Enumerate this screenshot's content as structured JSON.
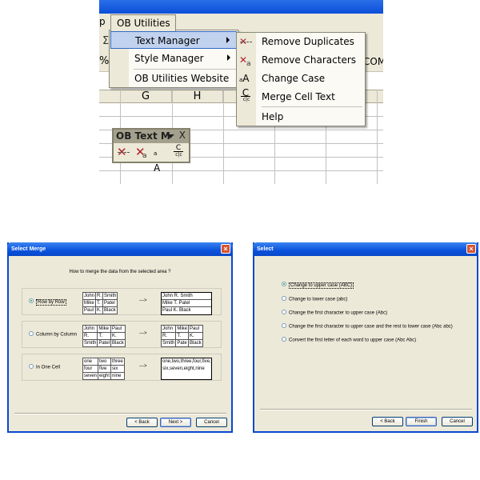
{
  "excel": {
    "menubar_partial_label": "p",
    "menubar_active": "OB Utilities",
    "toolbar_partial": {
      "sigma": "Σ",
      "percent": "%",
      "com": "COM"
    },
    "columns": [
      "G",
      "H"
    ],
    "main_menu": [
      {
        "label": "Text Manager",
        "has_submenu": true,
        "selected": true
      },
      {
        "label": "Style Manager",
        "has_submenu": true,
        "selected": false
      },
      {
        "label": "OB Utilities Website",
        "has_submenu": false,
        "selected": false
      }
    ],
    "submenu": [
      {
        "label": "Remove Duplicates",
        "icon": "remove-duplicates-icon"
      },
      {
        "label": "Remove Characters",
        "icon": "remove-characters-icon"
      },
      {
        "label": "Change Case",
        "icon": "change-case-icon"
      },
      {
        "label": "Merge Cell Text",
        "icon": "merge-cell-text-icon"
      },
      {
        "label": "Help",
        "icon": ""
      }
    ],
    "floating_toolbar": {
      "title": "OB Text M",
      "close": "X",
      "icons": [
        "remove-duplicates-icon",
        "remove-characters-icon",
        "change-case-icon",
        "merge-cell-text-icon"
      ]
    }
  },
  "icon_glyphs": {
    "x": "✕",
    "case_small": "a",
    "case_big": "A",
    "merge_top": "C",
    "merge_bottom": "c|c"
  },
  "merge_dialog": {
    "title": "Select Merge",
    "close_icon": "×",
    "question": "How to merge the data from the selected area ?",
    "arrow": "--->",
    "options": [
      {
        "label": "Row by Row",
        "selected": true,
        "source": [
          [
            "John",
            "R.",
            "Smith"
          ],
          [
            "Mike",
            "T.",
            "Patel"
          ],
          [
            "Paul",
            "K.",
            "Black"
          ]
        ],
        "result": [
          "John R. Smith",
          "Mike T. Patel",
          "Paul K. Black"
        ]
      },
      {
        "label": "Column by Column",
        "selected": false,
        "source": [
          [
            "John",
            "Mike",
            "Paul"
          ],
          [
            "R.",
            "T.",
            "K."
          ],
          [
            "Smith",
            "Patel",
            "Black"
          ]
        ],
        "result_table": [
          [
            "John",
            "Mike",
            "Paul"
          ],
          [
            "R.",
            "T.",
            "K."
          ],
          [
            "Smith",
            "Pate",
            "Black"
          ]
        ]
      },
      {
        "label": "In One Cell",
        "selected": false,
        "source": [
          [
            "one",
            "two",
            "three"
          ],
          [
            "four",
            "five",
            "six"
          ],
          [
            "seven",
            "eight",
            "nine"
          ]
        ],
        "result_text": "one,two,three,four,five,six,seven,eight,nine"
      }
    ],
    "buttons": {
      "back": "< Back",
      "next": "Next >",
      "cancel": "Cancel"
    }
  },
  "case_dialog": {
    "title": "Select",
    "close_icon": "×",
    "options": [
      {
        "label": "Change to upper case  (ABC)",
        "selected": true
      },
      {
        "label": "Change to lower case  (abc)",
        "selected": false
      },
      {
        "label": "Change the first character to upper case  (Abc)",
        "selected": false
      },
      {
        "label": "Change the first character to upper case and the rest to lower case  (Abc abc)",
        "selected": false
      },
      {
        "label": "Convert the first letter of each word to upper case  (Abc  Abc)",
        "selected": false
      }
    ],
    "buttons": {
      "back": "< Back",
      "finish": "Finish",
      "cancel": "Cancel"
    }
  }
}
